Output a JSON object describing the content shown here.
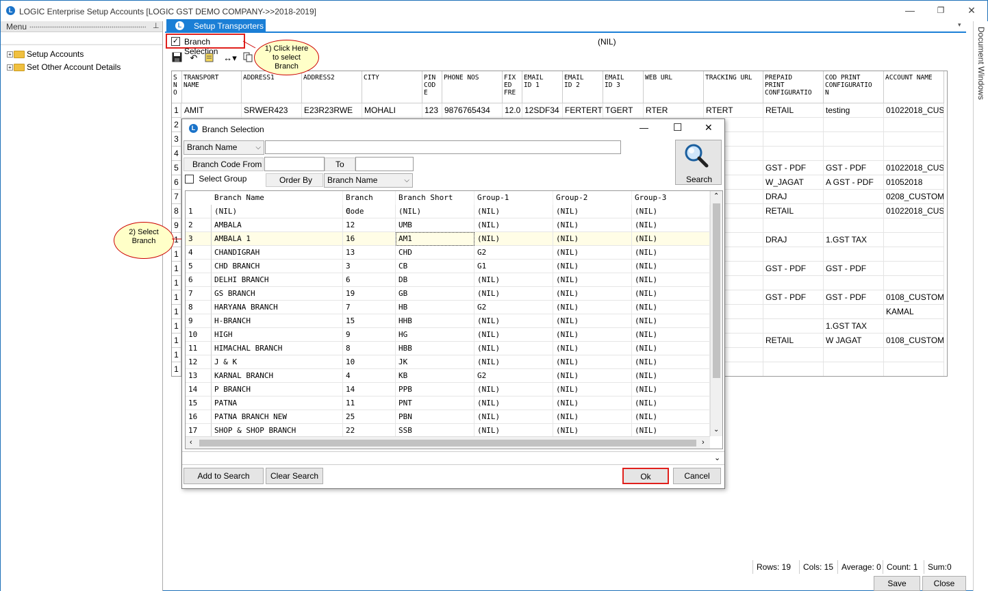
{
  "window": {
    "title": "LOGIC Enterprise Setup Accounts  [LOGIC GST DEMO COMPANY->>2018-2019]",
    "logo_letter": "L",
    "minimize": "—",
    "restore": "❐",
    "close": "✕"
  },
  "menu": {
    "header": "Menu",
    "pin": "ᵖ",
    "items": [
      {
        "label": "Setup Accounts"
      },
      {
        "label": "Set Other Account Details"
      }
    ]
  },
  "tab": {
    "label": "Setup Transporters",
    "icon": "L"
  },
  "doc_windows": "Document Windows",
  "branch_selection": {
    "label": "Branch Selection",
    "checked": "✓",
    "value": "(NIL)"
  },
  "callouts": {
    "one": "1) Click Here\nto select\nBranch",
    "two": "2) Select\nBranch"
  },
  "main_grid": {
    "headers": [
      {
        "k": "sno",
        "label": "S\nN\nO"
      },
      {
        "k": "tname",
        "label": "TRANSPORT\nNAME"
      },
      {
        "k": "a1",
        "label": "ADDRESS1"
      },
      {
        "k": "a2",
        "label": "ADDRESS2"
      },
      {
        "k": "city",
        "label": "CITY"
      },
      {
        "k": "pin",
        "label": "PIN\nCOD\nE"
      },
      {
        "k": "phone",
        "label": "PHONE NOS"
      },
      {
        "k": "fix",
        "label": "FIX\nED\nFRE"
      },
      {
        "k": "e1",
        "label": "EMAIL\nID 1"
      },
      {
        "k": "e2",
        "label": "EMAIL\nID 2"
      },
      {
        "k": "e3",
        "label": "EMAIL\nID 3"
      },
      {
        "k": "web",
        "label": "WEB URL"
      },
      {
        "k": "track",
        "label": "TRACKING URL"
      },
      {
        "k": "prepaid",
        "label": "PREPAID\nPRINT\nCONFIGURATIO"
      },
      {
        "k": "cod",
        "label": "COD PRINT\nCONFIGURATIO\nN"
      },
      {
        "k": "acc",
        "label": "ACCOUNT NAME"
      }
    ],
    "row1": [
      "AMIT",
      "SRWER423",
      "E23R23RWE",
      "MOHALI",
      "123",
      "9876765434",
      "12.0",
      "12SDF34",
      "FERTERT",
      "TGERT",
      "RTER",
      "RTERT",
      "RETAIL",
      "testing",
      "01022018_CUS"
    ],
    "row_numbers": [
      "1",
      "2",
      "3",
      "4",
      "5",
      "6",
      "7",
      "8",
      "9",
      "1",
      "1",
      "1",
      "1",
      "1",
      "1",
      "1",
      "1",
      "1",
      "1"
    ],
    "right_cells": [
      {
        "row": 4,
        "prepaid": "GST - PDF",
        "cod": "GST - PDF",
        "acc": "01022018_CUS"
      },
      {
        "row": 5,
        "prepaid": "W_JAGAT",
        "cod": "A GST - PDF",
        "acc": "01052018"
      },
      {
        "row": 6,
        "prepaid": "DRAJ",
        "cod": "",
        "acc": "0208_CUSTOM"
      },
      {
        "row": 7,
        "prepaid": "RETAIL",
        "cod": "",
        "acc": "01022018_CUS"
      },
      {
        "row": 9,
        "prepaid": "DRAJ",
        "cod": "1.GST TAX",
        "acc": ""
      },
      {
        "row": 11,
        "prepaid": "GST - PDF",
        "cod": "GST - PDF",
        "acc": ""
      },
      {
        "row": 13,
        "prepaid": "GST - PDF",
        "cod": "GST - PDF",
        "acc": "0108_CUSTOM"
      },
      {
        "row": 14,
        "prepaid": "",
        "cod": "",
        "acc": "KAMAL"
      },
      {
        "row": 15,
        "prepaid": "",
        "cod": "1.GST TAX",
        "acc": ""
      },
      {
        "row": 16,
        "prepaid": "RETAIL",
        "cod": "W JAGAT",
        "acc": "0108_CUSTOM"
      }
    ]
  },
  "status": {
    "rows": "Rows: 19",
    "cols": "Cols: 15",
    "avg": "Average: 0",
    "count": "Count: 1",
    "sum": "Sum:0"
  },
  "buttons": {
    "save": "Save",
    "close": "Close"
  },
  "dialog": {
    "title": "Branch Selection",
    "icon": "L",
    "minimize": "—",
    "maximize": "☐",
    "close": "✕",
    "field_select": "Branch Name",
    "search_value": "",
    "code_from_label": "Branch Code From",
    "code_from_value": "",
    "to_label": "To",
    "to_value": "",
    "select_group": "Select Group",
    "order_by_label": "Order By",
    "order_by_value": "Branch Name",
    "search_btn": "Search",
    "columns": [
      "Branch Name",
      "Branch Code",
      "Branch Short",
      "Group-1",
      "Group-2",
      "Group-3"
    ],
    "rows": [
      [
        "1",
        "(NIL)",
        "0",
        "(NIL)",
        "(NIL)",
        "(NIL)",
        "(NIL)"
      ],
      [
        "2",
        "AMBALA",
        "12",
        "UMB",
        "(NIL)",
        "(NIL)",
        "(NIL)"
      ],
      [
        "3",
        "AMBALA 1",
        "16",
        "AM1",
        "(NIL)",
        "(NIL)",
        "(NIL)"
      ],
      [
        "4",
        "CHANDIGRAH",
        "13",
        "CHD",
        "G2",
        "(NIL)",
        "(NIL)"
      ],
      [
        "5",
        "CHD BRANCH",
        "3",
        "CB",
        "G1",
        "(NIL)",
        "(NIL)"
      ],
      [
        "6",
        "DELHI BRANCH",
        "6",
        "DB",
        "(NIL)",
        "(NIL)",
        "(NIL)"
      ],
      [
        "7",
        "GS BRANCH",
        "19",
        "GB",
        "(NIL)",
        "(NIL)",
        "(NIL)"
      ],
      [
        "8",
        "HARYANA BRANCH",
        "7",
        "HB",
        "G2",
        "(NIL)",
        "(NIL)"
      ],
      [
        "9",
        "H-BRANCH",
        "15",
        "HHB",
        "(NIL)",
        "(NIL)",
        "(NIL)"
      ],
      [
        "10",
        "HIGH",
        "9",
        "HG",
        "(NIL)",
        "(NIL)",
        "(NIL)"
      ],
      [
        "11",
        "HIMACHAL BRANCH",
        "8",
        "HBB",
        "(NIL)",
        "(NIL)",
        "(NIL)"
      ],
      [
        "12",
        "J & K",
        "10",
        "JK",
        "(NIL)",
        "(NIL)",
        "(NIL)"
      ],
      [
        "13",
        "KARNAL BRANCH",
        "4",
        "KB",
        "G2",
        "(NIL)",
        "(NIL)"
      ],
      [
        "14",
        "P BRANCH",
        "14",
        "PPB",
        "(NIL)",
        "(NIL)",
        "(NIL)"
      ],
      [
        "15",
        "PATNA",
        "11",
        "PNT",
        "(NIL)",
        "(NIL)",
        "(NIL)"
      ],
      [
        "16",
        "PATNA BRANCH NEW",
        "25",
        "PBN",
        "(NIL)",
        "(NIL)",
        "(NIL)"
      ],
      [
        "17",
        "SHOP & SHOP BRANCH",
        "22",
        "SSB",
        "(NIL)",
        "(NIL)",
        "(NIL)"
      ]
    ],
    "selected_row": 3,
    "add_to_search": "Add to Search",
    "clear_search": "Clear Search",
    "ok": "Ok",
    "cancel": "Cancel"
  },
  "colors": {
    "accent": "#1b7fd6",
    "highlight": "#e0201c",
    "callout_bg": "#ffffc8",
    "selected_row": "#fffde6"
  }
}
